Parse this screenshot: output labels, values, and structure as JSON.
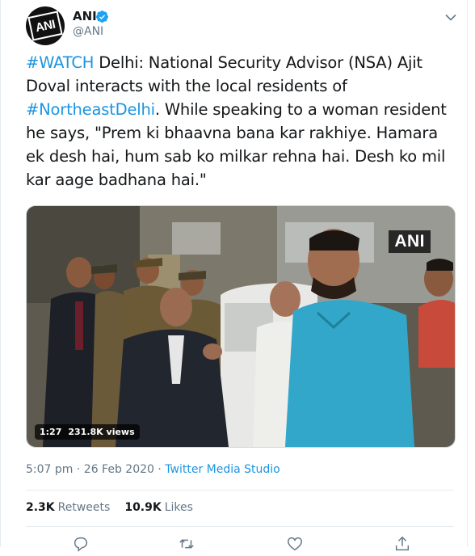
{
  "account": {
    "display_name": "ANI",
    "handle": "@ANI",
    "avatar_text": "ANI"
  },
  "tweet": {
    "hashtag1": "#WATCH",
    "text1": " Delhi: National Security Advisor (NSA) Ajit Doval interacts with the local residents of ",
    "hashtag2": "#NortheastDelhi",
    "text2": ". While speaking to a woman resident he says, \"Prem ki bhaavna bana kar rakhiye. Hamara ek desh hai, hum sab ko milkar rehna hai. Desh ko mil kar aage badhana hai.\""
  },
  "media": {
    "watermark": "ANI",
    "duration": "1:27",
    "views": "231.8K views"
  },
  "meta": {
    "time": "5:07 pm",
    "separator1": " · ",
    "date": "26 Feb 2020",
    "separator2": " · ",
    "source": "Twitter Media Studio"
  },
  "stats": {
    "retweets_count": "2.3K",
    "retweets_label": "Retweets",
    "likes_count": "10.9K",
    "likes_label": "Likes"
  },
  "colors": {
    "link": "#1b95e0",
    "verified": "#1da1f2",
    "secondary_text": "#657786"
  },
  "icons": [
    "verified-badge-icon",
    "chevron-down-icon",
    "reply-icon",
    "retweet-icon",
    "like-icon",
    "share-icon"
  ]
}
